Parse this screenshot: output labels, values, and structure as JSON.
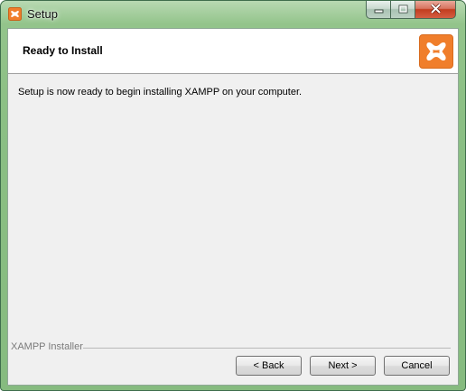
{
  "window": {
    "title": "Setup",
    "app_icon": "xampp-icon",
    "caption_buttons": [
      {
        "name": "minimize-icon"
      },
      {
        "name": "maximize-icon"
      },
      {
        "name": "close-icon"
      }
    ]
  },
  "header": {
    "title": "Ready to Install",
    "logo_icon": "xampp-logo-icon"
  },
  "main": {
    "message": "Setup is now ready to begin installing XAMPP on your computer."
  },
  "footer": {
    "group_label": "XAMPP Installer",
    "buttons": {
      "back": "< Back",
      "next": "Next >",
      "cancel": "Cancel"
    }
  },
  "colors": {
    "brand_orange": "#f07e2b",
    "frame_green": "#8bbf84",
    "close_red": "#c23c1f"
  }
}
